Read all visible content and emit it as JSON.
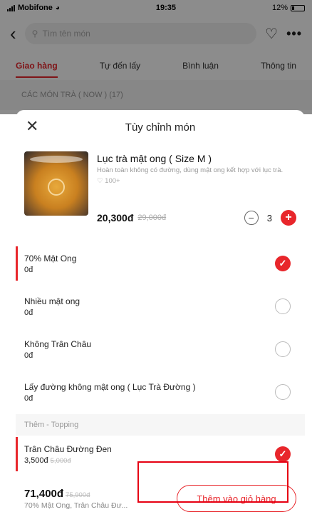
{
  "status": {
    "carrier": "Mobifone",
    "time": "19:35",
    "battery": "12%"
  },
  "header": {
    "search_placeholder": "Tìm tên món"
  },
  "tabs": [
    "Giao hàng",
    "Tự đến lấy",
    "Bình luận",
    "Thông tin"
  ],
  "bg_section": "CÁC MÓN TRÀ ( NOW ) (17)",
  "sheet": {
    "title": "Tùy chỉnh món",
    "product": {
      "name": "Lục trà mật ong ( Size M )",
      "description": "Hoàn toàn không có đường, dùng mật ong kết hợp với lục trà.",
      "sold": "100+",
      "price": "20,300đ",
      "old_price": "29,000đ",
      "quantity": "3"
    },
    "options": [
      {
        "name": "70% Mật Ong",
        "cost": "0đ",
        "selected": true
      },
      {
        "name": "Nhiều mật ong",
        "cost": "0đ",
        "selected": false
      },
      {
        "name": "Không Trân Châu",
        "cost": "0đ",
        "selected": false
      },
      {
        "name": "Lấy đường không mật ong ( Lục Trà Đường )",
        "cost": "0đ",
        "selected": false
      }
    ],
    "topping_group": "Thêm - Topping",
    "toppings": [
      {
        "name": "Trân Châu Đường Đen",
        "cost": "3,500đ",
        "old_cost": "5,000đ",
        "selected": true
      }
    ],
    "footer": {
      "total": "71,400đ",
      "old_total": "75,900đ",
      "summary": "70% Mật Ong, Trân Châu Đư...",
      "add_label": "Thêm vào giỏ hàng"
    }
  },
  "colors": {
    "accent": "#e8262b",
    "highlight": "#e60012"
  }
}
